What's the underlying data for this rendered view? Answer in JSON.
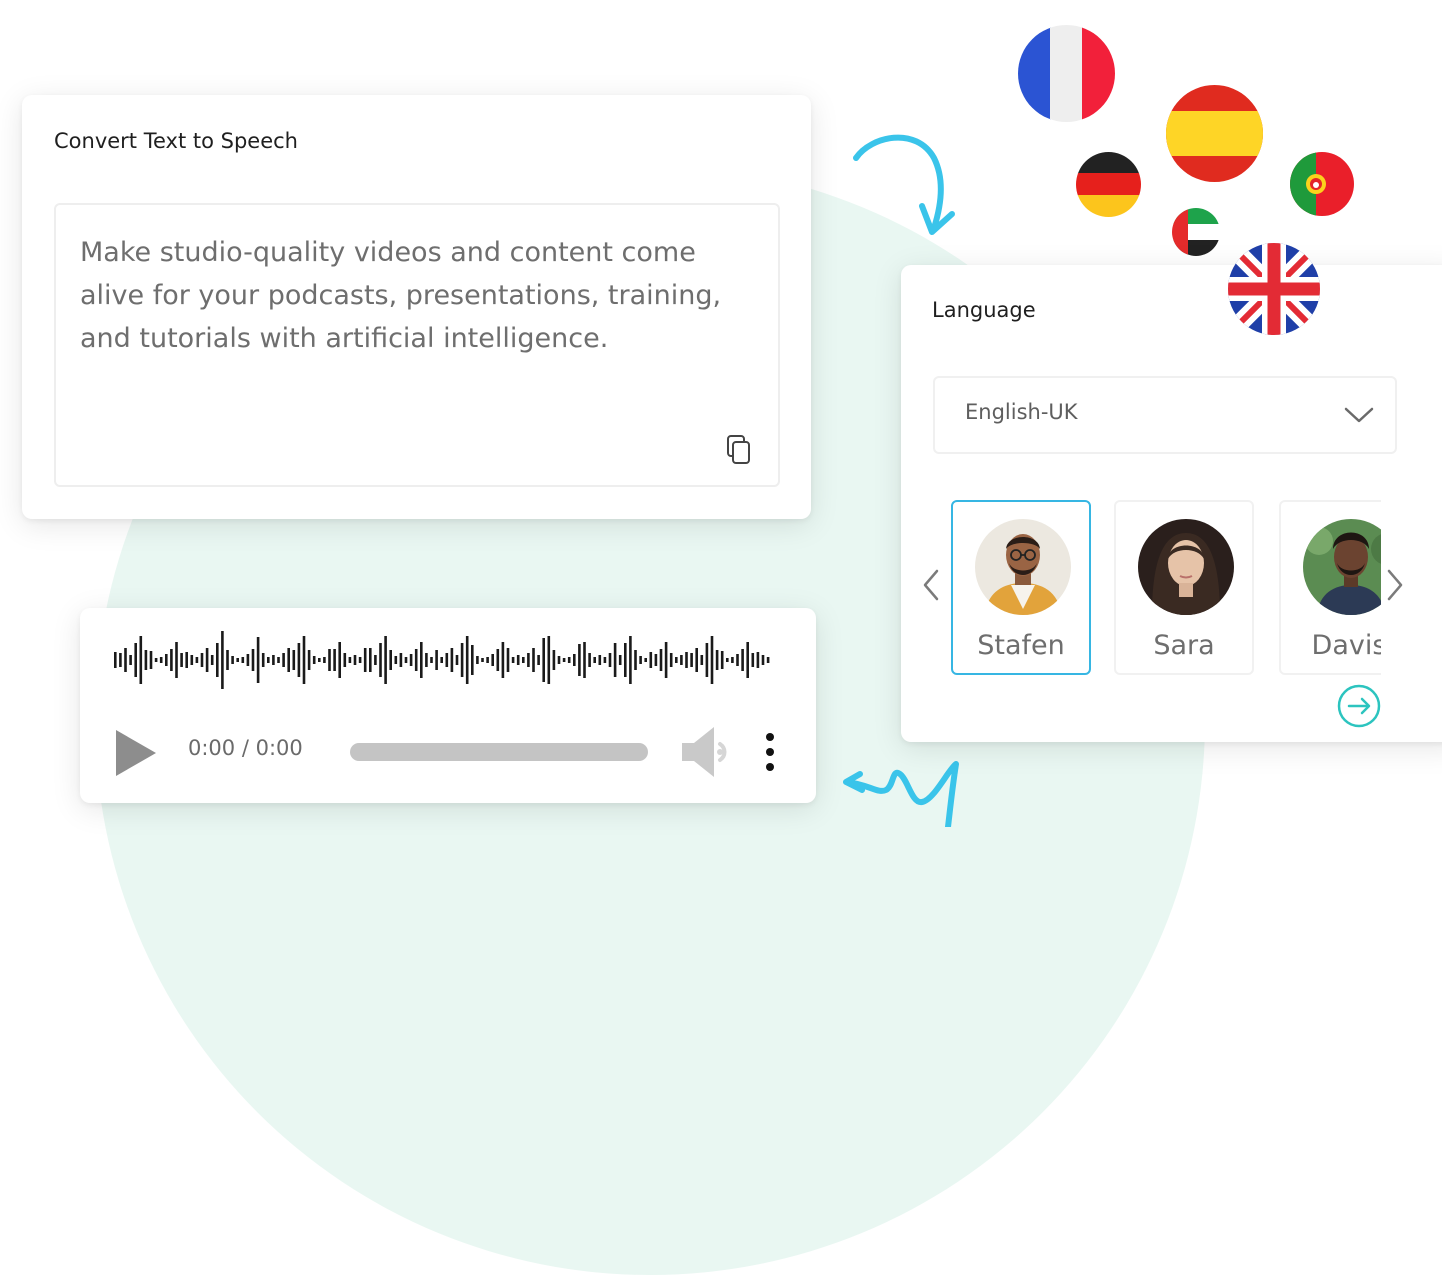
{
  "tts": {
    "title": "Convert Text to Speech",
    "text": "Make studio-quality videos and content come alive for your podcasts, presentations, training, and tutorials with artificial intelligence."
  },
  "player": {
    "time": "0:00 / 0:00",
    "progress": 0
  },
  "language": {
    "title": "Language",
    "selected": "English-UK"
  },
  "voices": [
    {
      "name": "Stafen",
      "selected": true
    },
    {
      "name": "Sara",
      "selected": false
    },
    {
      "name": "Davis",
      "selected": false
    }
  ],
  "flags": [
    "france-flag",
    "spain-flag",
    "germany-flag",
    "portugal-flag",
    "uae-flag",
    "uk-flag"
  ],
  "colors": {
    "accent": "#2cc4bf",
    "selected_border": "#36b6e3",
    "arrow": "#3ac4ea",
    "background_circle": "#e9f7f2"
  }
}
